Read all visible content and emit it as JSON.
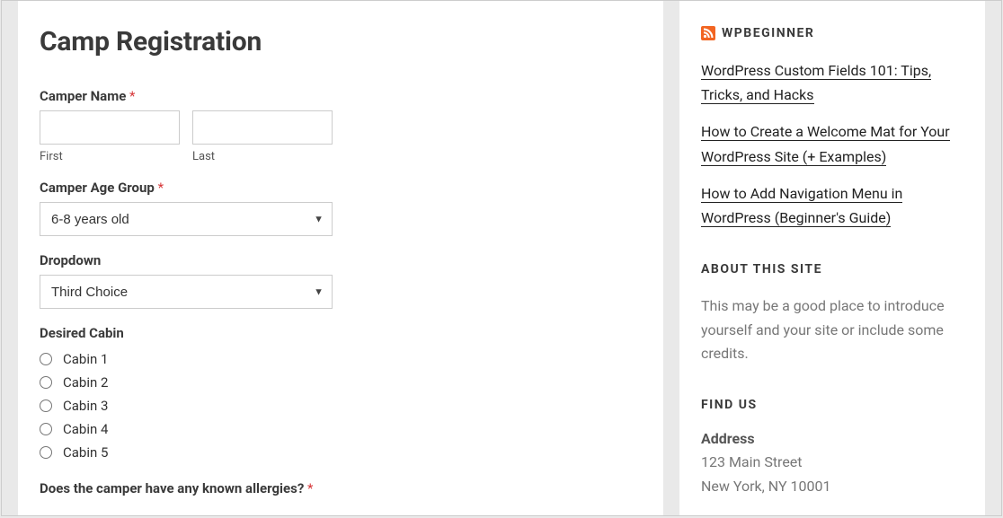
{
  "form": {
    "title": "Camp Registration",
    "camper_name": {
      "label": "Camper Name",
      "required_mark": "*",
      "first_value": "",
      "first_sublabel": "First",
      "last_value": "",
      "last_sublabel": "Last"
    },
    "age_group": {
      "label": "Camper Age Group",
      "required_mark": "*",
      "selected": "6-8 years old"
    },
    "dropdown": {
      "label": "Dropdown",
      "selected": "Third Choice"
    },
    "cabin": {
      "label": "Desired Cabin",
      "options": [
        "Cabin 1",
        "Cabin 2",
        "Cabin 3",
        "Cabin 4",
        "Cabin 5"
      ]
    },
    "allergies": {
      "label": "Does the camper have any known allergies?",
      "required_mark": "*"
    }
  },
  "sidebar": {
    "rss": {
      "title": "WPBEGINNER",
      "items": [
        "WordPress Custom Fields 101: Tips, Tricks, and Hacks",
        "How to Create a Welcome Mat for Your WordPress Site (+ Examples)",
        "How to Add Navigation Menu in WordPress (Beginner's Guide)"
      ]
    },
    "about": {
      "title": "ABOUT THIS SITE",
      "text": "This may be a good place to introduce yourself and your site or include some credits."
    },
    "findus": {
      "title": "FIND US",
      "sub": "Address",
      "line1": "123 Main Street",
      "line2": "New York, NY 10001"
    }
  }
}
